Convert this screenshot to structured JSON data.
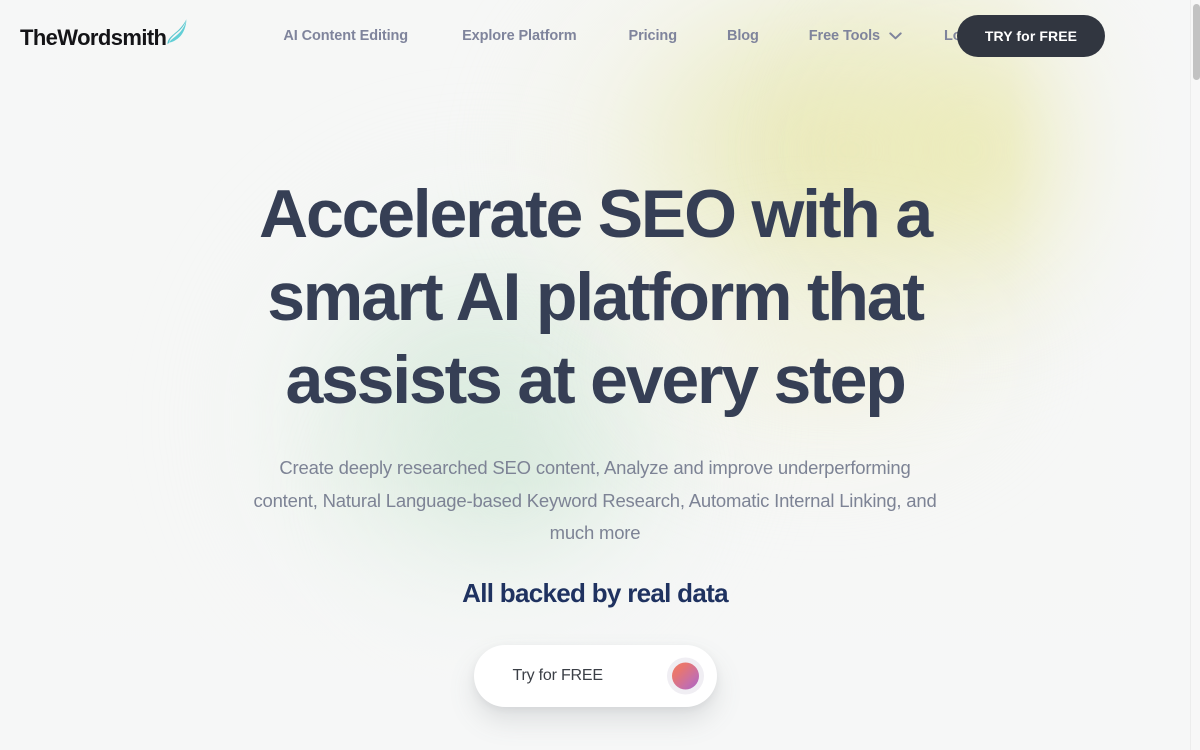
{
  "header": {
    "logo": {
      "text": "TheWordsmith",
      "quill_icon": "quill-feather-icon",
      "quill_color": "#5cc6cf"
    },
    "nav_items": [
      {
        "label": "AI Content Editing",
        "has_dropdown": false
      },
      {
        "label": "Explore Platform",
        "has_dropdown": false
      },
      {
        "label": "Pricing",
        "has_dropdown": false
      },
      {
        "label": "Blog",
        "has_dropdown": false
      },
      {
        "label": "Free Tools",
        "has_dropdown": true,
        "dropdown_icon": "chevron-down-icon"
      },
      {
        "label": "Login",
        "has_dropdown": false
      }
    ],
    "cta_button": {
      "label": "TRY for FREE",
      "background": "#313640",
      "text_color": "#ffffff"
    }
  },
  "hero": {
    "headline": "Accelerate SEO with a smart AI platform that assists at every step",
    "headline_color": "#363f55",
    "subheadline": "Create deeply researched SEO content, Analyze and improve underperforming content, Natural Language-based Keyword Research, Automatic Internal Linking, and much more",
    "subheadline_color": "#7d8395",
    "tagline": "All backed by real data",
    "tagline_color": "#1f3260",
    "cta_button": {
      "label": "Try for FREE",
      "background": "#ffffff",
      "text_color": "#3b3f46",
      "orb_icon": "gradient-orb-icon",
      "orb_gradient_from": "#ef7b6a",
      "orb_gradient_to": "#a964c4"
    }
  },
  "background": {
    "base_color": "#f6f7f6",
    "glow_yellow": "#e7e6aa",
    "glow_green": "#cde5d3"
  },
  "scrollbar": {
    "track_color": "#f7f7f7",
    "thumb_color": "#c2c2c2"
  }
}
